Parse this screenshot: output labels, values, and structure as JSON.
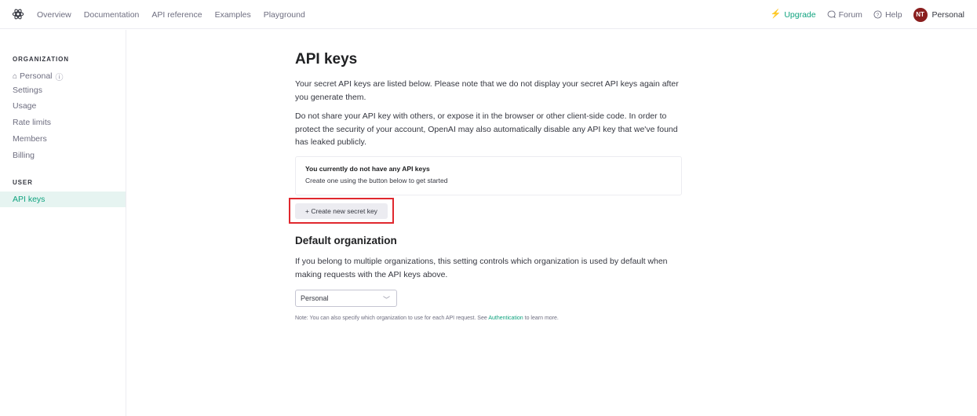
{
  "nav": {
    "links": [
      "Overview",
      "Documentation",
      "API reference",
      "Examples",
      "Playground"
    ],
    "upgrade": "Upgrade",
    "forum": "Forum",
    "help": "Help",
    "avatar_initials": "NT",
    "account": "Personal"
  },
  "sidebar": {
    "org_heading": "ORGANIZATION",
    "org_items": [
      "Personal",
      "Settings",
      "Usage",
      "Rate limits",
      "Members",
      "Billing"
    ],
    "user_heading": "USER",
    "user_items": [
      "API keys"
    ]
  },
  "main": {
    "title": "API keys",
    "intro": "Your secret API keys are listed below. Please note that we do not display your secret API keys again after you generate them.",
    "warning": "Do not share your API key with others, or expose it in the browser or other client-side code. In order to protect the security of your account, OpenAI may also automatically disable any API key that we've found has leaked publicly.",
    "empty_title": "You currently do not have any API keys",
    "empty_sub": "Create one using the button below to get started",
    "create_button": "+ Create new secret key",
    "default_org_title": "Default organization",
    "default_org_desc": "If you belong to multiple organizations, this setting controls which organization is used by default when making requests with the API keys above.",
    "select_value": "Personal",
    "note_prefix": "Note: You can also specify which organization to use for each API request. See ",
    "note_link": "Authentication",
    "note_suffix": " to learn more."
  },
  "colors": {
    "accent": "#10a37f",
    "highlight": "#e0282e"
  }
}
